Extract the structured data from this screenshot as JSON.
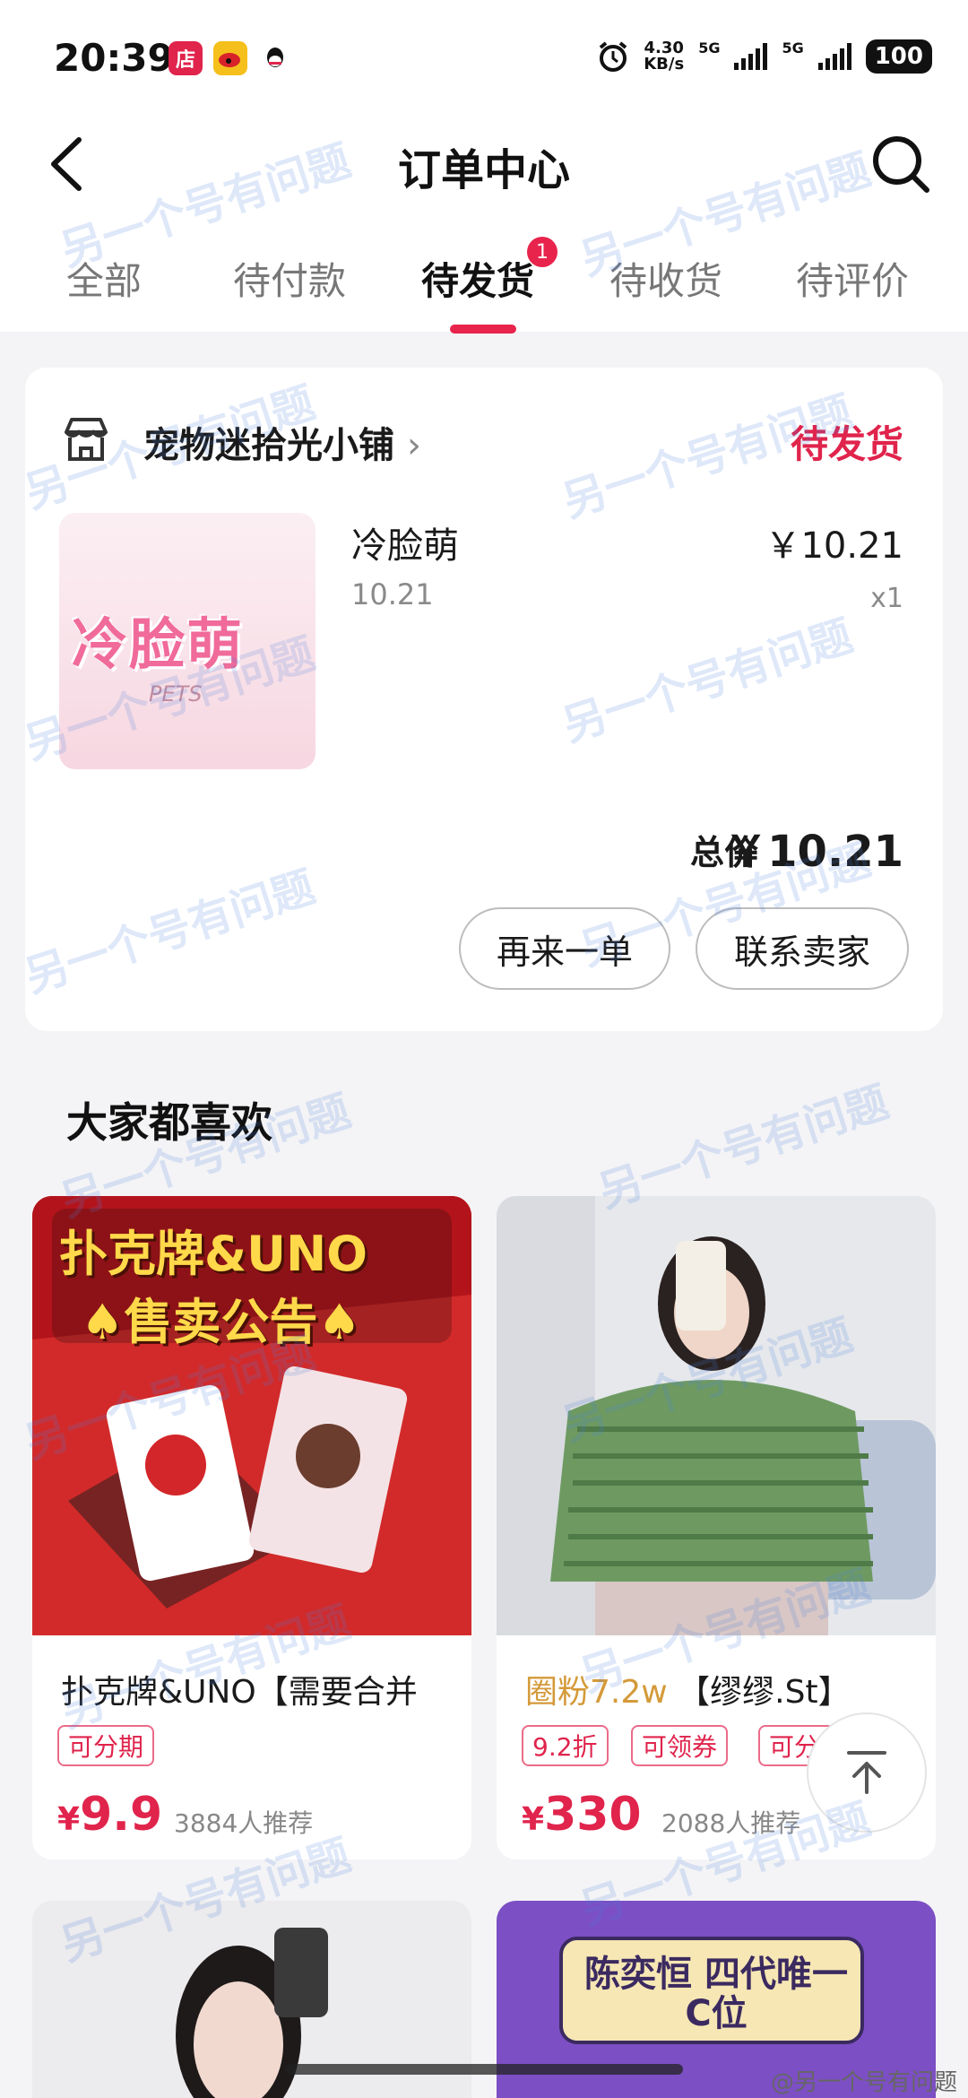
{
  "status_bar": {
    "time": "20:39",
    "apps": [
      {
        "name": "shop-app-icon",
        "label": "店",
        "color": "#e0244c"
      },
      {
        "name": "weibo-app-icon",
        "label": "",
        "color": "#f5c01b"
      },
      {
        "name": "qq-app-icon",
        "label": "",
        "color": "#ffffff"
      }
    ],
    "net_speed_value": "4.30",
    "net_speed_unit": "KB/s",
    "network1": "5G",
    "network2": "5G",
    "battery": "100"
  },
  "header": {
    "title": "订单中心",
    "tabs": [
      {
        "label": "全部"
      },
      {
        "label": "待付款"
      },
      {
        "label": "待发货",
        "active": true,
        "badge": "1"
      },
      {
        "label": "待收货"
      },
      {
        "label": "待评价"
      }
    ]
  },
  "order": {
    "shop_name": "宠物迷拾光小铺",
    "status": "待发货",
    "product_image_title": "冷脸萌",
    "product_name": "冷脸萌",
    "product_spec": "10.21",
    "product_price": "￥10.21",
    "product_qty": "x1",
    "total_label": "总价",
    "total_value": "￥10.21",
    "buttons": {
      "reorder": "再来一单",
      "contact": "联系卖家"
    }
  },
  "recommend": {
    "title": "大家都喜欢",
    "items": [
      {
        "image_line1": "扑克牌&UNO",
        "image_line2": "♠售卖公告♠",
        "name": "扑克牌&UNO【需要合并",
        "tags": [
          "可分期"
        ],
        "price_symbol": "¥",
        "price": "9.9",
        "recommend_count": "3884人推荐"
      },
      {
        "name_prefix": "圈粉7.2w",
        "name": "【缪缪.St】",
        "tags": [
          "9.2折",
          "可领券",
          "可分期"
        ],
        "price_symbol": "¥",
        "price": "330",
        "recommend_count": "2088人推荐"
      }
    ],
    "next_item_text": "陈奕恒 四代唯一C位"
  },
  "watermark": {
    "text": "另一个号有问题",
    "corner": "@另一个号有问题"
  },
  "colors": {
    "accent": "#e0244c",
    "background": "#f4f4f6",
    "card": "#ffffff"
  }
}
